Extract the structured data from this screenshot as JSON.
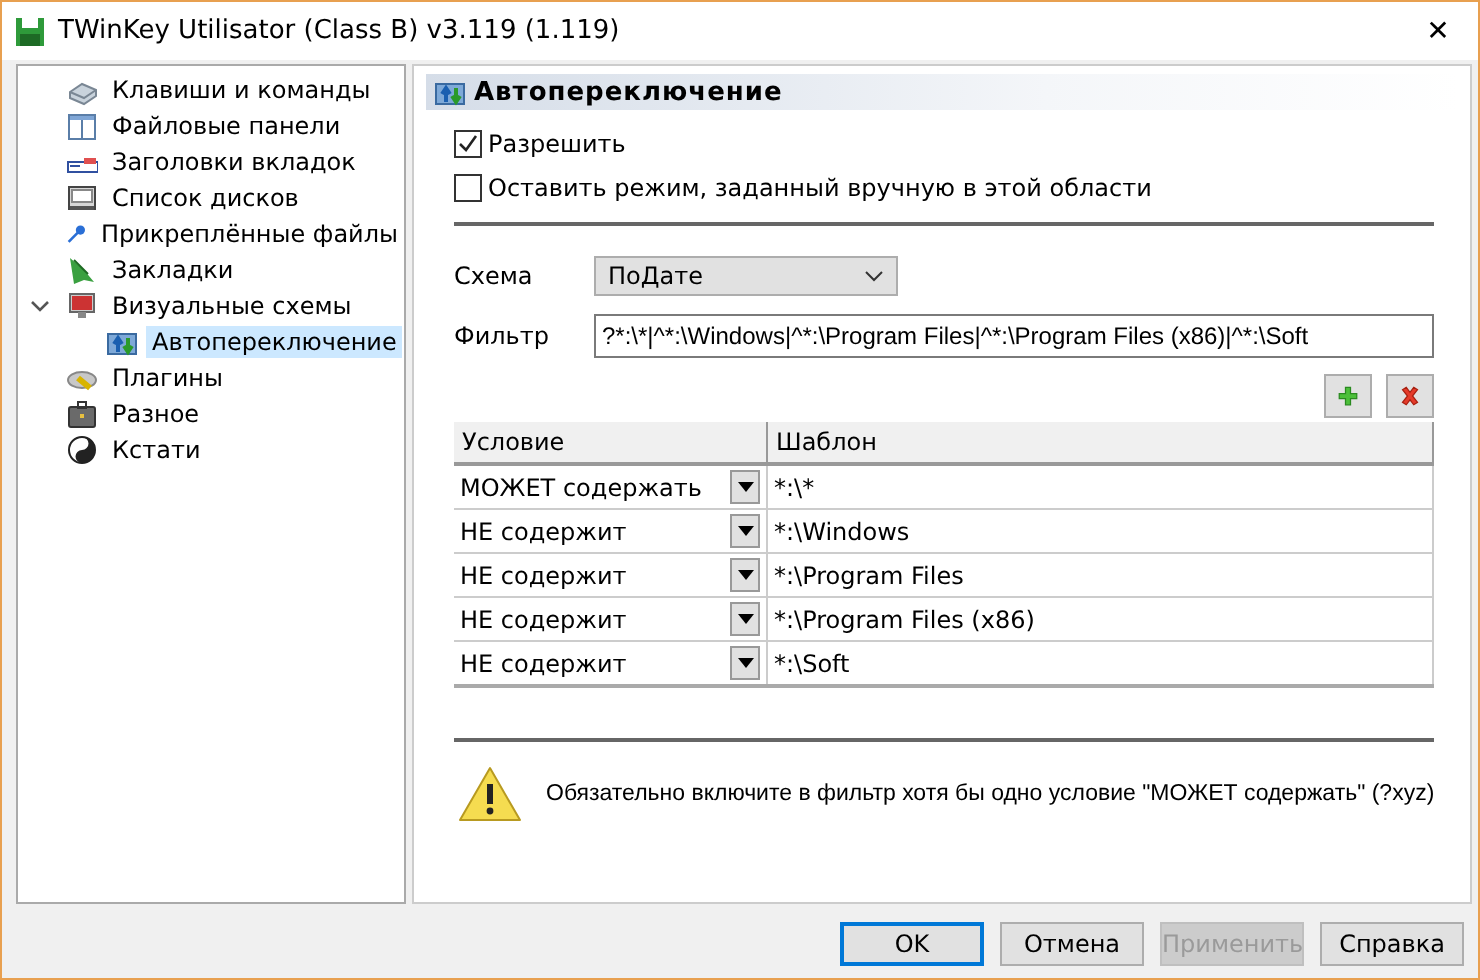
{
  "window": {
    "title": "TWinKey Utilisator (Class B) v3.119 (1.119)",
    "close": "✕"
  },
  "tree": [
    {
      "label": "Клавиши и команды",
      "selected": false
    },
    {
      "label": "Файловые панели",
      "selected": false
    },
    {
      "label": "Заголовки вкладок",
      "selected": false
    },
    {
      "label": "Список дисков",
      "selected": false
    },
    {
      "label": "Прикреплённые файлы",
      "selected": false
    },
    {
      "label": "Закладки",
      "selected": false
    },
    {
      "label": "Визуальные схемы",
      "selected": false,
      "expanded": true,
      "children": [
        {
          "label": "Автопереключение",
          "selected": true
        }
      ]
    },
    {
      "label": "Плагины",
      "selected": false
    },
    {
      "label": "Разное",
      "selected": false
    },
    {
      "label": "Кстати",
      "selected": false
    }
  ],
  "panel": {
    "title": "Автопереключение",
    "checkboxes": [
      {
        "label": "Разрешить",
        "checked": true
      },
      {
        "label": "Оставить режим, заданный вручную в этой области",
        "checked": false
      }
    ],
    "scheme": {
      "label": "Схема",
      "value": "ПоДате"
    },
    "filter": {
      "label": "Фильтр",
      "value": "?*:\\*|^*:\\Windows|^*:\\Program Files|^*:\\Program Files (x86)|^*:\\Soft"
    },
    "table": {
      "columns": [
        "Условие",
        "Шаблон"
      ],
      "rows": [
        {
          "condition": "МОЖЕТ содержать",
          "pattern": "*:\\*"
        },
        {
          "condition": "НЕ содержит",
          "pattern": "*:\\Windows"
        },
        {
          "condition": "НЕ содержит",
          "pattern": "*:\\Program Files"
        },
        {
          "condition": "НЕ содержит",
          "pattern": "*:\\Program Files (x86)"
        },
        {
          "condition": "НЕ содержит",
          "pattern": "*:\\Soft"
        }
      ]
    },
    "warning": "Обязательно включите в фильтр хотя бы одно условие \"МОЖЕТ содержать\" (?xyz)"
  },
  "buttons": [
    {
      "label": "OK",
      "default": true,
      "disabled": false
    },
    {
      "label": "Отмена",
      "default": false,
      "disabled": false
    },
    {
      "label": "Применить",
      "default": false,
      "disabled": true
    },
    {
      "label": "Справка",
      "default": false,
      "disabled": false
    }
  ]
}
